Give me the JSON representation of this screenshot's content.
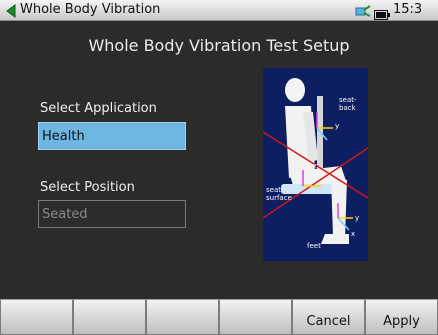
{
  "status_bar": {
    "title": "Whole Body Vibration",
    "time": "15:3"
  },
  "screen": {
    "title": "Whole Body Vibration Test Setup"
  },
  "application": {
    "label": "Select  Application",
    "value": "Health"
  },
  "position": {
    "label": "Select  Position",
    "value": "Seated"
  },
  "diagram": {
    "labels": {
      "seat_back": [
        "seat-",
        "back"
      ],
      "seat_surface": [
        "seat-",
        "surface"
      ],
      "feet": "feet",
      "y1": "y",
      "y2": "y",
      "z": "z",
      "x": "x"
    }
  },
  "softkeys": [
    "",
    "",
    "",
    "",
    "Cancel",
    "Apply"
  ]
}
